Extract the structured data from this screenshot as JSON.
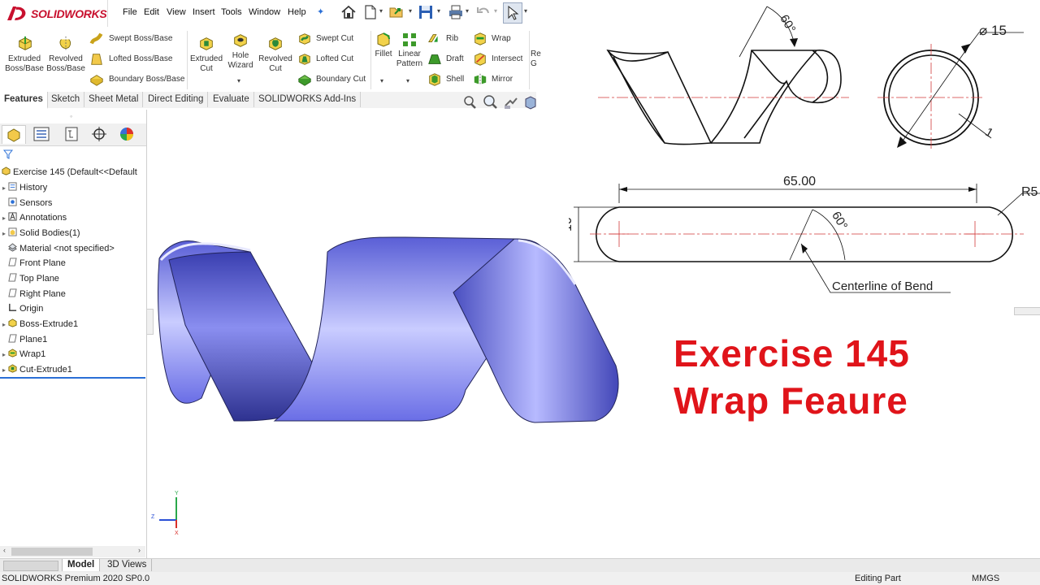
{
  "app": {
    "brand": "SOLIDWORKS"
  },
  "menu": [
    "File",
    "Edit",
    "View",
    "Insert",
    "Tools",
    "Window",
    "Help"
  ],
  "ribbon": {
    "extruded_boss": "Extruded\nBoss/Base",
    "revolved_boss": "Revolved\nBoss/Base",
    "swept_boss": "Swept Boss/Base",
    "lofted_boss": "Lofted Boss/Base",
    "boundary_boss": "Boundary Boss/Base",
    "extruded_cut": "Extruded\nCut",
    "hole_wizard": "Hole\nWizard",
    "revolved_cut": "Revolved\nCut",
    "swept_cut": "Swept Cut",
    "lofted_cut": "Lofted Cut",
    "boundary_cut": "Boundary Cut",
    "fillet": "Fillet",
    "linear_pattern": "Linear\nPattern",
    "rib": "Rib",
    "draft": "Draft",
    "shell": "Shell",
    "wrap": "Wrap",
    "intersect": "Intersect",
    "mirror": "Mirror",
    "overflow": "Re\nG"
  },
  "tabs": [
    "Features",
    "Sketch",
    "Sheet Metal",
    "Direct Editing",
    "Evaluate",
    "SOLIDWORKS Add-Ins"
  ],
  "tree": {
    "root": "Exercise 145  (Default<<Default",
    "items": [
      {
        "label": "History",
        "arrow": true
      },
      {
        "label": "Sensors",
        "arrow": false
      },
      {
        "label": "Annotations",
        "arrow": true
      },
      {
        "label": "Solid Bodies(1)",
        "arrow": true
      },
      {
        "label": "Material <not specified>",
        "arrow": false
      },
      {
        "label": "Front Plane",
        "arrow": false
      },
      {
        "label": "Top Plane",
        "arrow": false
      },
      {
        "label": "Right Plane",
        "arrow": false
      },
      {
        "label": "Origin",
        "arrow": false
      },
      {
        "label": "Boss-Extrude1",
        "arrow": true
      },
      {
        "label": "Plane1",
        "arrow": false
      },
      {
        "label": "Wrap1",
        "arrow": true
      },
      {
        "label": "Cut-Extrude1",
        "arrow": true
      }
    ]
  },
  "bottom_tabs": [
    "Model",
    "3D Views"
  ],
  "status": {
    "left": "SOLIDWORKS Premium 2020 SP0.0",
    "editing": "Editing Part",
    "units": "MMGS"
  },
  "drawing": {
    "angle_top": "60°",
    "diameter_15": "15",
    "thickness": "1",
    "length": "65.00",
    "radius": "R5",
    "diameter_10": "10",
    "angle_slot": "60°",
    "centerline_note": "Centerline of Bend"
  },
  "triad": {
    "y": "Y",
    "z": "Z",
    "x": "X"
  },
  "headline": {
    "line1": "Exercise 145",
    "line2": "Wrap Feaure"
  },
  "colors": {
    "accent": "#e0141a",
    "model": "#7b7ff0"
  }
}
